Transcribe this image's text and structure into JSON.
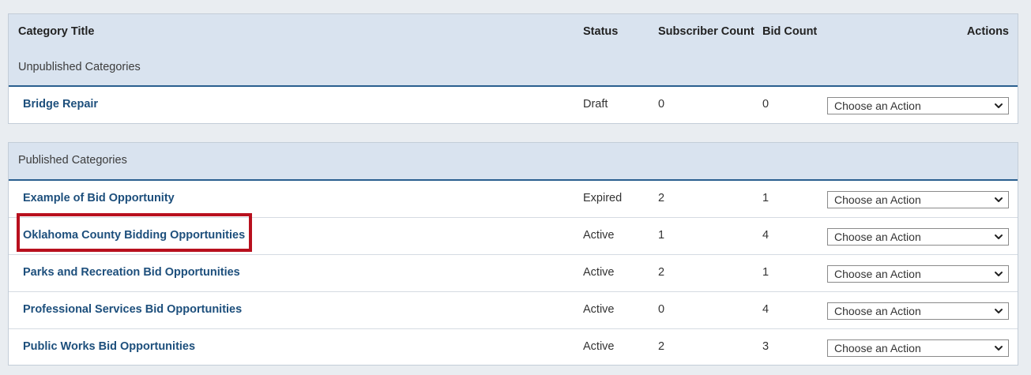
{
  "columns": {
    "category_title": "Category Title",
    "status": "Status",
    "subscriber_count": "Subscriber Count",
    "bid_count": "Bid Count",
    "actions": "Actions"
  },
  "unpublished": {
    "label": "Unpublished Categories",
    "rows": [
      {
        "title": "Bridge Repair",
        "status": "Draft",
        "subscribers": "0",
        "bids": "0",
        "action": "Choose an Action"
      }
    ]
  },
  "published": {
    "label": "Published Categories",
    "rows": [
      {
        "title": "Example of Bid Opportunity",
        "status": "Expired",
        "subscribers": "2",
        "bids": "1",
        "action": "Choose an Action"
      },
      {
        "title": "Oklahoma County Bidding Opportunities",
        "status": "Active",
        "subscribers": "1",
        "bids": "4",
        "action": "Choose an Action"
      },
      {
        "title": "Parks and Recreation Bid Opportunities",
        "status": "Active",
        "subscribers": "2",
        "bids": "1",
        "action": "Choose an Action"
      },
      {
        "title": "Professional Services Bid Opportunities",
        "status": "Active",
        "subscribers": "0",
        "bids": "4",
        "action": "Choose an Action"
      },
      {
        "title": "Public Works Bid Opportunities",
        "status": "Active",
        "subscribers": "2",
        "bids": "3",
        "action": "Choose an Action"
      }
    ]
  },
  "colors": {
    "header_bg": "#d9e3ef",
    "header_rule": "#2a5f8f",
    "link": "#1d4f7c",
    "highlight": "#b8101e"
  }
}
